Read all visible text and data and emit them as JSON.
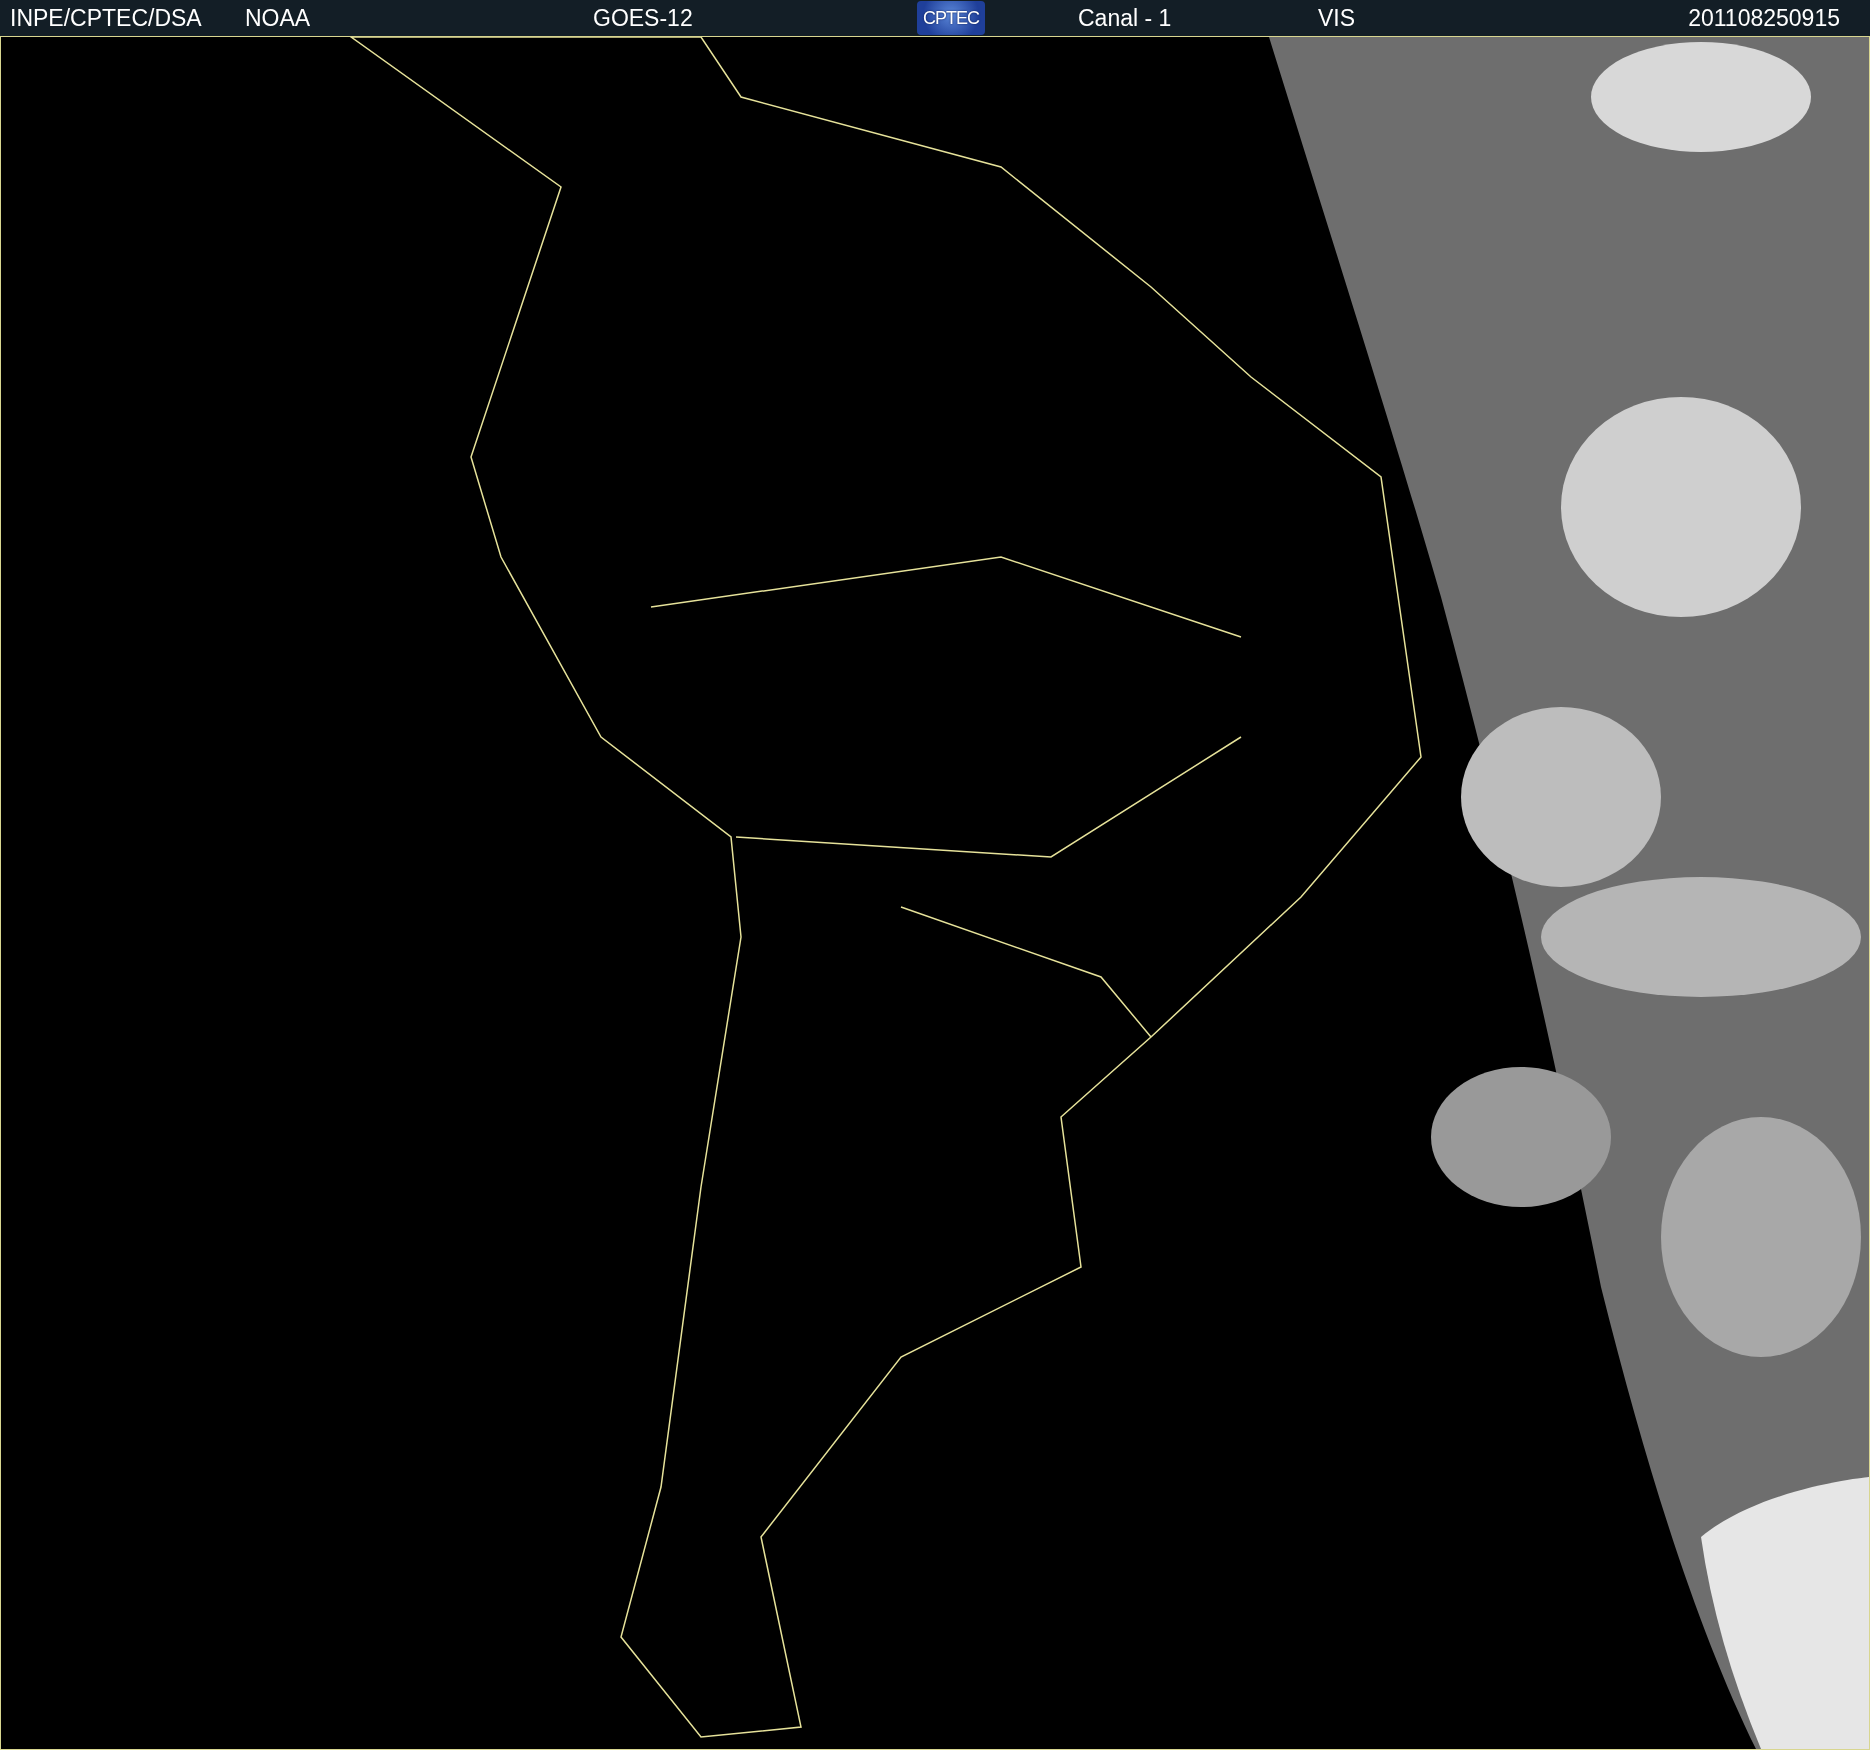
{
  "header": {
    "source": "INPE/CPTEC/DSA",
    "agency": "NOAA",
    "satellite": "GOES-12",
    "logo": "CPTEC",
    "channel": "Canal - 1",
    "band": "VIS",
    "timestamp": "201108250915"
  }
}
